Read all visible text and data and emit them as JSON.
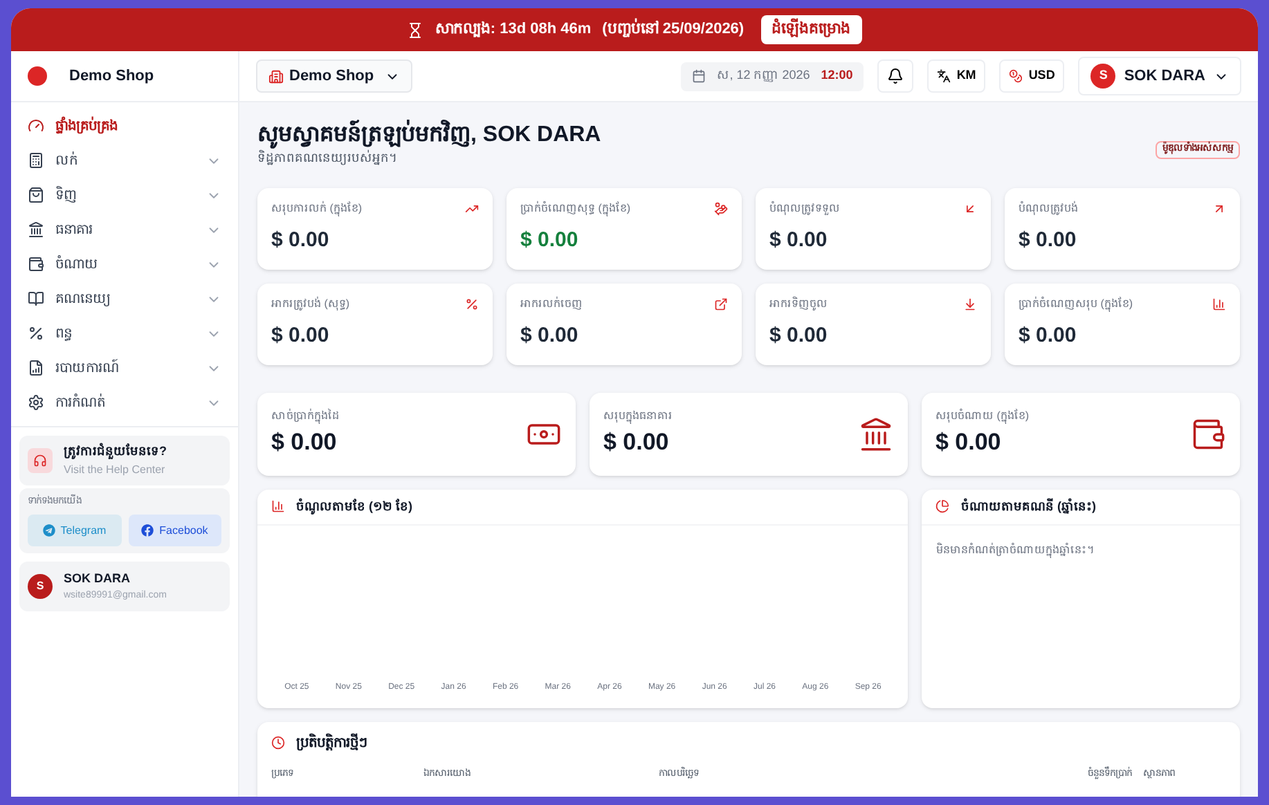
{
  "banner": {
    "trial": "សាកល្បង: 13d 08h 46m",
    "ends": "(បញ្ចប់នៅ 25/09/2026)",
    "upgrade_button": "ដំឡើងគម្រោង"
  },
  "sidebar": {
    "brand": "Demo Shop",
    "items": [
      {
        "label": "ផ្ទាំងគ្រប់គ្រង",
        "selected": true,
        "expandable": false
      },
      {
        "label": "លក់",
        "selected": false,
        "expandable": true
      },
      {
        "label": "ទិញ",
        "selected": false,
        "expandable": true
      },
      {
        "label": "ធនាគារ",
        "selected": false,
        "expandable": true
      },
      {
        "label": "ចំណាយ",
        "selected": false,
        "expandable": true
      },
      {
        "label": "គណនេយ្យ",
        "selected": false,
        "expandable": true
      },
      {
        "label": "ពន្ធ",
        "selected": false,
        "expandable": true
      },
      {
        "label": "របាយការណ៍",
        "selected": false,
        "expandable": true
      },
      {
        "label": "ការកំណត់",
        "selected": false,
        "expandable": true
      }
    ],
    "help": {
      "title": "ត្រូវការជំនួយមែនទេ?",
      "link": "Visit the Help Center"
    },
    "contact": {
      "label": "ទាក់ទងមកយើង",
      "buttons": [
        "Telegram",
        "Facebook"
      ]
    },
    "user": {
      "initial": "S",
      "name": "SOK DARA",
      "email": "wsite89991@gmail.com"
    }
  },
  "header": {
    "shop_select": "Demo Shop",
    "date": "ស, 12 កញ្ញា 2026",
    "time": "12:00",
    "language": "KM",
    "currency": "USD",
    "user_initial": "S",
    "user_name": "SOK DARA"
  },
  "welcome": {
    "title": "សូមស្វាគមន៍ត្រឡប់មកវិញ, SOK DARA",
    "subtitle": "ទិដ្ឋភាពគណនេយ្យរបស់អ្នក។",
    "badge": "ម៉ូឌុលទាំងអស់សកម្ម"
  },
  "stats": [
    {
      "label": "សរុបការលក់ (ក្នុងខែ)",
      "value": "$ 0.00",
      "positive": false
    },
    {
      "label": "ប្រាក់ចំណេញសុទ្ធ (ក្នុងខែ)",
      "value": "$ 0.00",
      "positive": true
    },
    {
      "label": "បំណុលត្រូវទទួល",
      "value": "$ 0.00",
      "positive": false
    },
    {
      "label": "បំណុលត្រូវបង់",
      "value": "$ 0.00",
      "positive": false
    },
    {
      "label": "អាករត្រូវបង់ (សុទ្ធ)",
      "value": "$ 0.00",
      "positive": false
    },
    {
      "label": "អាករលក់ចេញ",
      "value": "$ 0.00",
      "positive": false
    },
    {
      "label": "អាករទិញចូល",
      "value": "$ 0.00",
      "positive": false
    },
    {
      "label": "ប្រាក់ចំណេញសរុប (ក្នុងខែ)",
      "value": "$ 0.00",
      "positive": false
    }
  ],
  "balances": [
    {
      "label": "សាច់ប្រាក់ក្នុងដៃ",
      "value": "$ 0.00"
    },
    {
      "label": "សរុបក្នុងធនាគារ",
      "value": "$ 0.00"
    },
    {
      "label": "សរុបចំណាយ (ក្នុងខែ)",
      "value": "$ 0.00"
    }
  ],
  "income_chart": {
    "title": "ចំណូលតាមខែ (១២ ខែ)",
    "months": [
      "Oct 25",
      "Nov 25",
      "Dec 25",
      "Jan 26",
      "Feb 26",
      "Mar 26",
      "Apr 26",
      "May 26",
      "Jun 26",
      "Jul 26",
      "Aug 26",
      "Sep 26"
    ]
  },
  "expense_panel": {
    "title": "ចំណាយតាមគណនី (ឆ្នាំនេះ)",
    "empty_message": "មិនមានកំណត់ត្រាចំណាយក្នុងឆ្នាំនេះ។"
  },
  "recent": {
    "title": "ប្រតិបត្តិការថ្មីៗ",
    "columns": [
      "ប្រភេទ",
      "ឯកសារយោង",
      "កាលបរិច្ឆេទ",
      "ចំនួនទឹកប្រាក់",
      "ស្ថានភាព"
    ]
  }
}
